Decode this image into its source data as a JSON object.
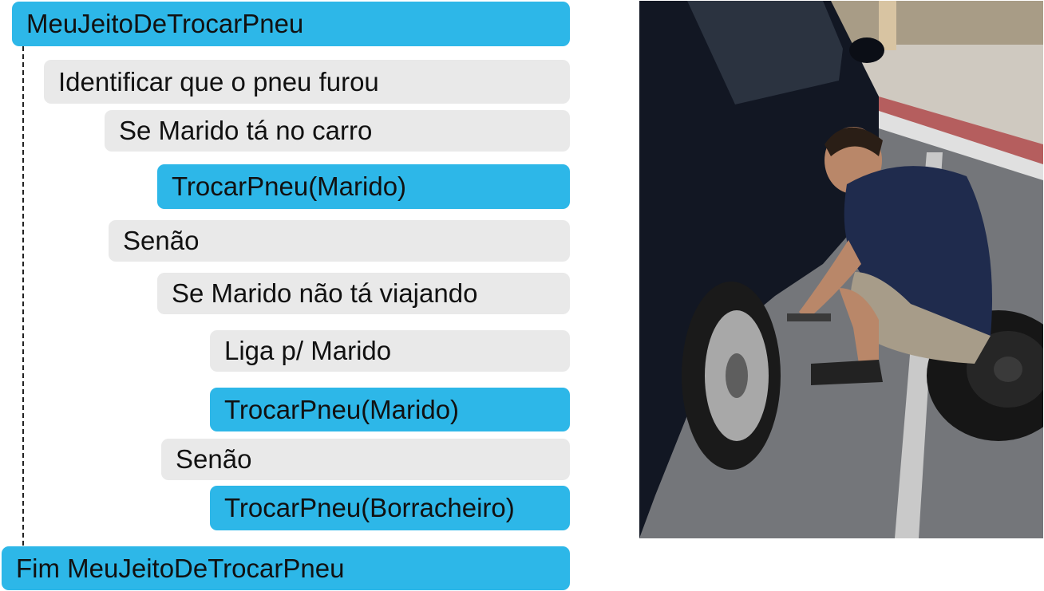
{
  "flow": {
    "start": "MeuJeitoDeTrocarPneu",
    "step1": "Identificar que o pneu furou",
    "if1": "Se Marido tá no carro",
    "call1": "TrocarPneu(Marido)",
    "else1": "Senão",
    "if2": "Se Marido não tá viajando",
    "step2": "Liga p/ Marido",
    "call2": "TrocarPneu(Marido)",
    "else2": "Senão",
    "call3": "TrocarPneu(Borracheiro)",
    "end": "Fim MeuJeitoDeTrocarPneu"
  },
  "colors": {
    "function_block": "#2db7e8",
    "statement_block": "#e9e9e9"
  }
}
